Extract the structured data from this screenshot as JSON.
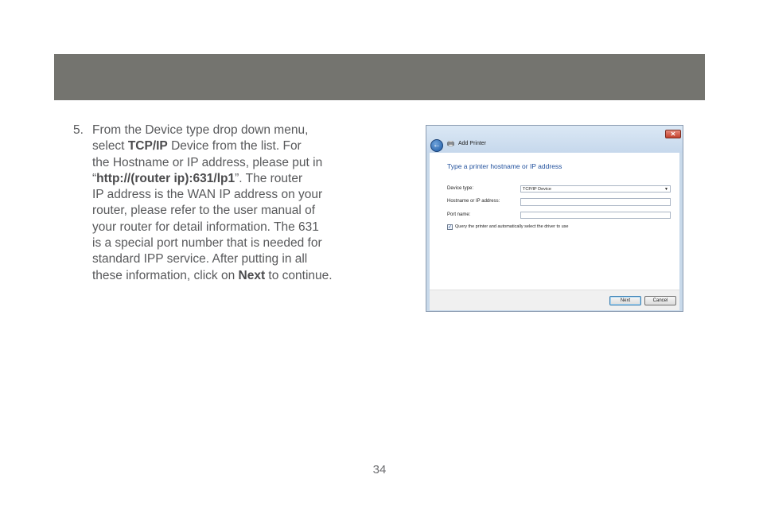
{
  "step": {
    "number": "5.",
    "lines": [
      [
        {
          "t": "From the Device type drop down menu,"
        }
      ],
      [
        {
          "t": "select "
        },
        {
          "t": "TCP/IP",
          "b": true
        },
        {
          "t": " Device from the list.  For"
        }
      ],
      [
        {
          "t": "the Hostname or IP address, please put in"
        }
      ],
      [
        {
          "t": "“"
        },
        {
          "t": "http://(router ip):631/lp1",
          "b": true
        },
        {
          "t": "”.  The router"
        }
      ],
      [
        {
          "t": "IP address is the WAN IP address on your"
        }
      ],
      [
        {
          "t": "router, please refer to the user manual of"
        }
      ],
      [
        {
          "t": "your router for detail information.  The 631"
        }
      ],
      [
        {
          "t": "is a special port number that is needed for"
        }
      ],
      [
        {
          "t": "standard IPP service.  After putting in all"
        }
      ],
      [
        {
          "t": "these information, click on "
        },
        {
          "t": "Next",
          "b": true
        },
        {
          "t": " to continue."
        }
      ]
    ]
  },
  "dialog": {
    "title": "Add Printer",
    "close_label": "✕",
    "back_icon": "back-arrow-icon",
    "heading": "Type a printer hostname or IP address",
    "device_type_label": "Device type:",
    "device_type_value": "TCP/IP Device",
    "hostname_label": "Hostname or IP address:",
    "hostname_value": "",
    "port_label": "Port name:",
    "port_value": "",
    "query_checked": true,
    "query_label": "Query the printer and automatically select the driver to use",
    "next_label": "Next",
    "cancel_label": "Cancel"
  },
  "page_number": "34",
  "colors": {
    "header_bar": "#74746f",
    "body_text": "#58595b",
    "dialog_heading": "#1f4f9c"
  }
}
